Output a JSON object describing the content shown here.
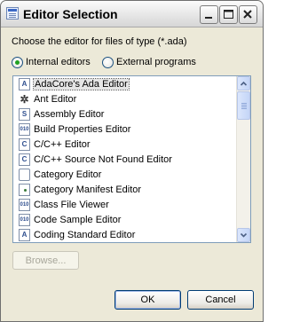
{
  "window": {
    "title": "Editor Selection"
  },
  "prompt": "Choose the editor for files of type (*.ada)",
  "mode": {
    "internal_label": "Internal editors",
    "external_label": "External programs",
    "selected": "internal"
  },
  "editors": [
    {
      "label": "AdaCore's Ada Editor",
      "icon": "ada-editor-icon",
      "selected": true
    },
    {
      "label": "Ant Editor",
      "icon": "ant-icon"
    },
    {
      "label": "Assembly Editor",
      "icon": "assembly-icon"
    },
    {
      "label": "Build Properties Editor",
      "icon": "properties-icon"
    },
    {
      "label": "C/C++ Editor",
      "icon": "cpp-icon"
    },
    {
      "label": "C/C++ Source Not Found Editor",
      "icon": "cpp-icon"
    },
    {
      "label": "Category Editor",
      "icon": "category-icon"
    },
    {
      "label": "Category Manifest Editor",
      "icon": "manifest-icon"
    },
    {
      "label": "Class File Viewer",
      "icon": "class-file-icon"
    },
    {
      "label": "Code Sample Editor",
      "icon": "code-sample-icon"
    },
    {
      "label": "Coding Standard Editor",
      "icon": "coding-standard-icon"
    }
  ],
  "buttons": {
    "browse": "Browse...",
    "ok": "OK",
    "cancel": "Cancel"
  },
  "colors": {
    "dialog_background": "#ece9d8",
    "radio_dot": "#21a121",
    "button_border": "#003c74"
  }
}
